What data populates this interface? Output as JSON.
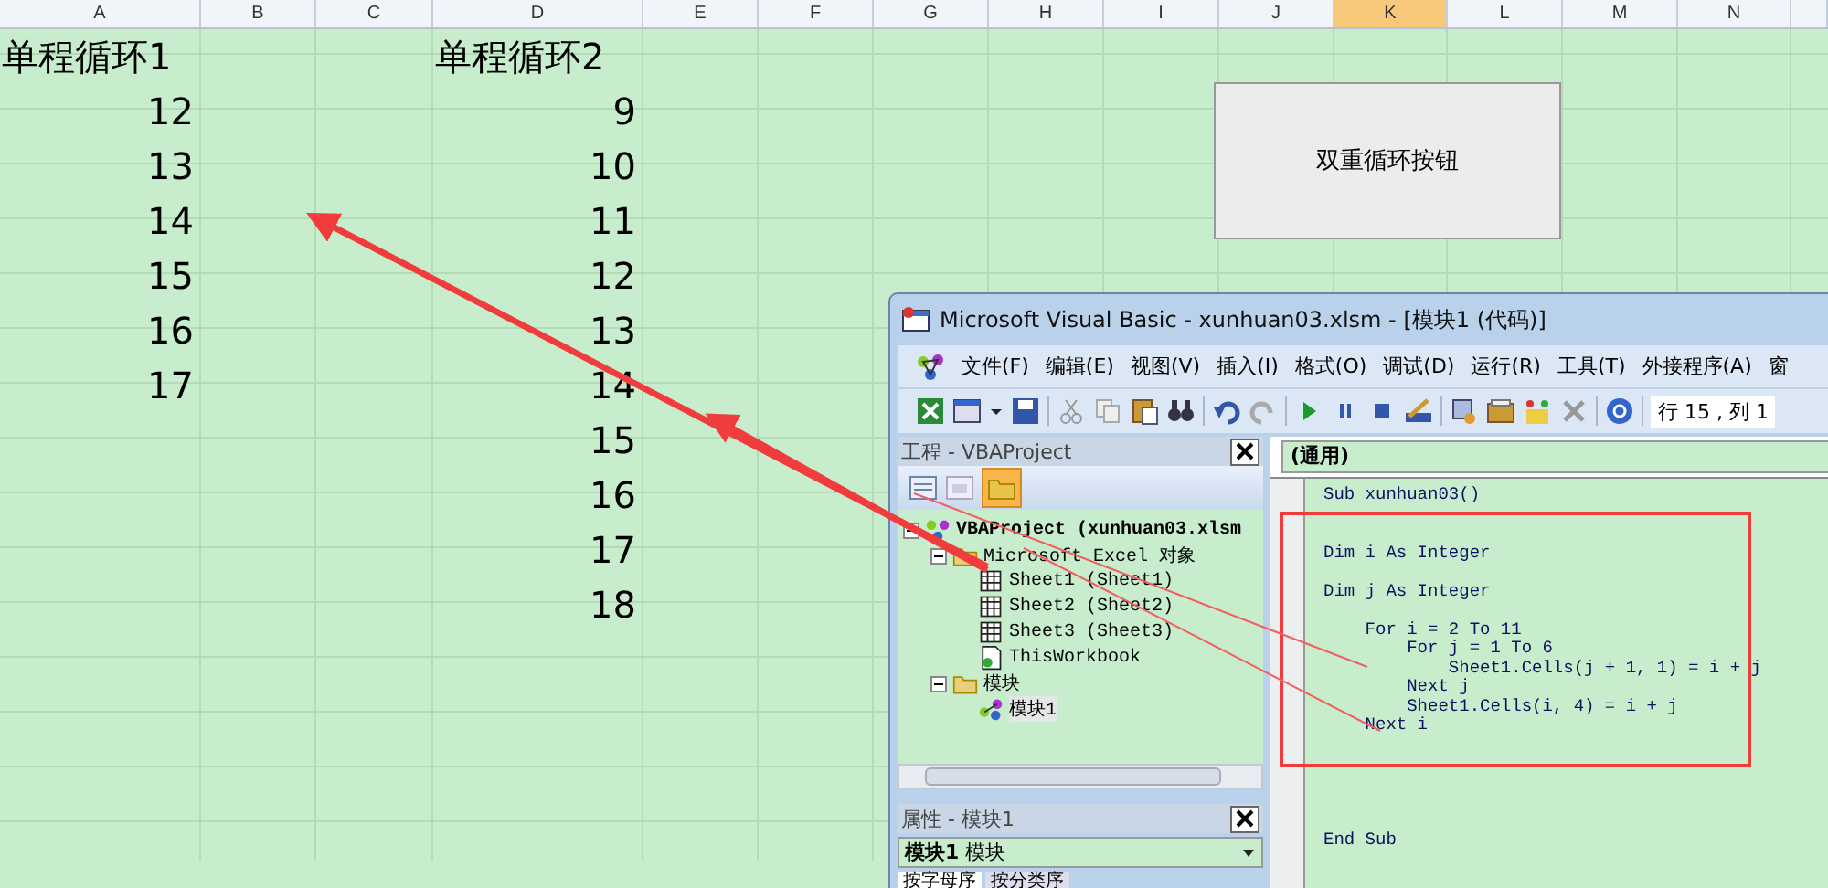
{
  "sheet": {
    "columns": [
      {
        "label": "A",
        "selected": false
      },
      {
        "label": "B",
        "selected": false
      },
      {
        "label": "C",
        "selected": false
      },
      {
        "label": "D",
        "selected": false
      },
      {
        "label": "E",
        "selected": false
      },
      {
        "label": "F",
        "selected": false
      },
      {
        "label": "G",
        "selected": false
      },
      {
        "label": "H",
        "selected": false
      },
      {
        "label": "I",
        "selected": false
      },
      {
        "label": "J",
        "selected": false
      },
      {
        "label": "K",
        "selected": true
      },
      {
        "label": "L",
        "selected": false
      },
      {
        "label": "M",
        "selected": false
      },
      {
        "label": "N",
        "selected": false
      }
    ],
    "title_row": {
      "A": "单程循环1",
      "D": "单程循环2"
    },
    "rows": [
      {
        "A": "12",
        "D": "9"
      },
      {
        "A": "13",
        "D": "10"
      },
      {
        "A": "14",
        "D": "11"
      },
      {
        "A": "15",
        "D": "12"
      },
      {
        "A": "16",
        "D": "13"
      },
      {
        "A": "17",
        "D": "14"
      },
      {
        "D": "15"
      },
      {
        "D": "16"
      },
      {
        "D": "17"
      },
      {
        "D": "18"
      }
    ],
    "button": "双重循环按钮"
  },
  "vba_window": {
    "title": "Microsoft Visual Basic - xunhuan03.xlsm - [模块1 (代码)]",
    "menu": [
      "文件(F)",
      "编辑(E)",
      "视图(V)",
      "插入(I)",
      "格式(O)",
      "调试(D)",
      "运行(R)",
      "工具(T)",
      "外接程序(A)",
      "窗"
    ],
    "cursor_position": "行 15 , 列 1",
    "project_pane": {
      "title": "工程 - VBAProject",
      "tree": [
        {
          "label": "VBAProject (xunhuan03.xlsm",
          "kind": "project",
          "expanded": true,
          "selected": false,
          "children": [
            {
              "label": "Microsoft Excel 对象",
              "kind": "folder",
              "expanded": true,
              "selected": false,
              "children": [
                {
                  "label": "Sheet1 (Sheet1)",
                  "kind": "sheet",
                  "selected": false
                },
                {
                  "label": "Sheet2 (Sheet2)",
                  "kind": "sheet",
                  "selected": false
                },
                {
                  "label": "Sheet3 (Sheet3)",
                  "kind": "sheet",
                  "selected": false
                },
                {
                  "label": "ThisWorkbook",
                  "kind": "workbook",
                  "selected": false
                }
              ]
            },
            {
              "label": "模块",
              "kind": "folder",
              "expanded": true,
              "selected": false,
              "children": [
                {
                  "label": "模块1",
                  "kind": "module",
                  "selected": true
                }
              ]
            }
          ]
        }
      ]
    },
    "properties_pane": {
      "title": "属性 - 模块1",
      "object": "**模块1** 模块",
      "tabs": [
        {
          "label": "按字母序",
          "selected": true
        },
        {
          "label": "按分类序",
          "selected": false
        }
      ]
    },
    "code_pane": {
      "object_dropdown": "(通用)",
      "blocks": [
        [
          "Sub xunhuan03()"
        ],
        [
          "Dim i As Integer"
        ],
        [
          "Dim j As Integer"
        ],
        [
          "    For i = 2 To 11",
          "        For j = 1 To 6",
          "            Sheet1.Cells(j + 1, 1) = i + j",
          "        Next j",
          "        Sheet1.Cells(i, 4) = i + j",
          "    Next i"
        ],
        [
          "End Sub"
        ]
      ]
    }
  }
}
